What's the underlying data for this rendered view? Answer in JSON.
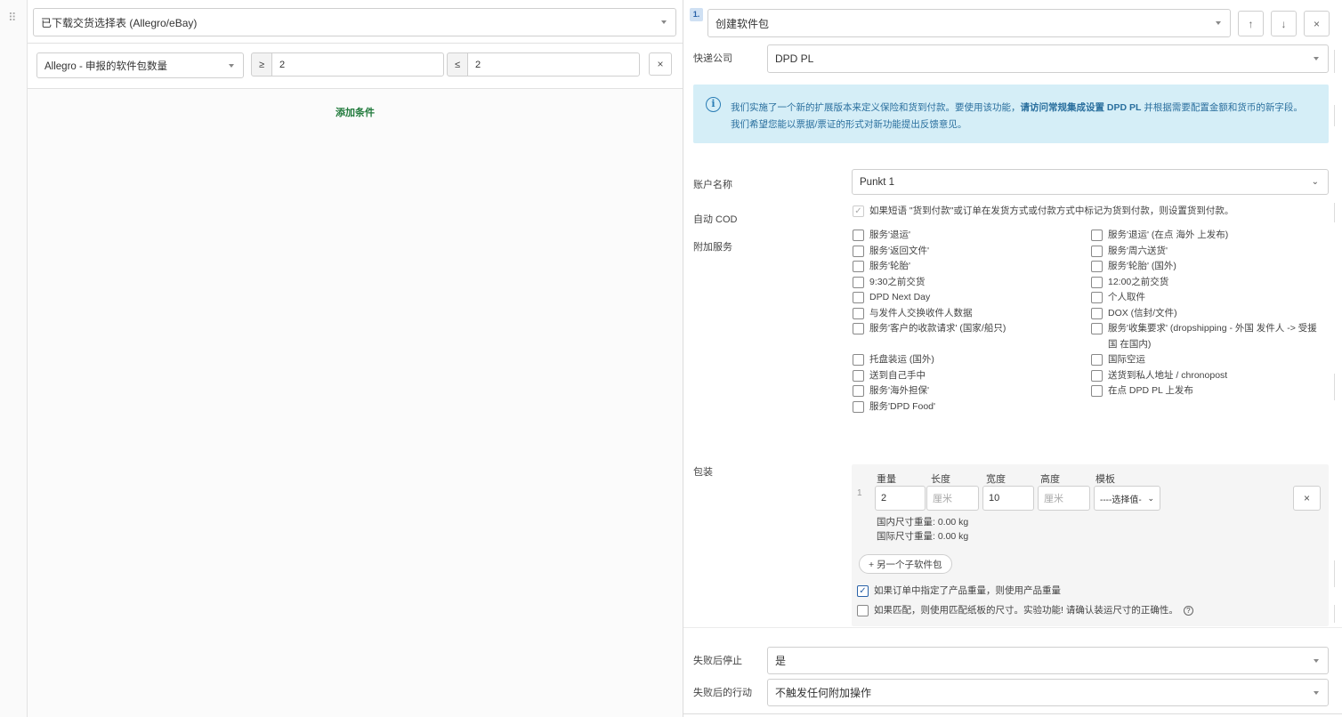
{
  "left": {
    "source_select": "已下载交货选择表 (Allegro/eBay)",
    "condition": {
      "field": "Allegro - 申报的软件包数量",
      "op_min": "≥",
      "min_value": "2",
      "op_max": "≤",
      "max_value": "2",
      "remove": "×"
    },
    "add_condition": "添加条件"
  },
  "right": {
    "badge": "1.",
    "action_select": "创建软件包",
    "move_up": "↑",
    "move_down": "↓",
    "remove": "×",
    "courier_label": "快递公司",
    "courier_value": "DPD PL",
    "info": {
      "icon": "i",
      "text1": "我们实施了一个新的扩展版本来定义保险和货到付款。要使用该功能，",
      "text_bold": "请访问常规集成设置 DPD PL",
      "text2": " 并根据需要配置金额和货币的新字段。",
      "text3": "我们希望您能以票据/票证的形式对新功能提出反馈意见。"
    },
    "account_label": "账户名称",
    "account_value": "Punkt 1",
    "auto_cod_label": "自动 COD",
    "auto_cod_text": "如果短语 \"货到付款\"或订单在发货方式或付款方式中标记为货到付款，则设置货到付款。",
    "extra_services_label": "附加服务",
    "services_left": [
      "服务'退运'",
      "服务'返回文件'",
      "服务'轮胎'",
      "9:30之前交货",
      "DPD Next Day",
      "与发件人交换收件人数据",
      "服务'客户的收款请求' (国家/船只)",
      "托盘装运 (国外)",
      "送到自己手中",
      "服务'海外担保'",
      "服务'DPD Food'"
    ],
    "services_right": [
      "服务'退运' (在点 海外 上发布)",
      "服务'周六送货'",
      "服务'轮胎' (国外)",
      "12:00之前交货",
      "个人取件",
      "DOX (信封/文件)",
      "服务'收集要求' (dropshipping - 外国 发件人 -> 受援国 在国内)",
      "国际空运",
      "送货到私人地址 / chronopost",
      "在点 DPD PL 上发布"
    ],
    "packaging_label": "包装",
    "package": {
      "index": "1",
      "h_weight": "重量",
      "h_length": "长度",
      "h_width": "宽度",
      "h_height": "高度",
      "h_template": "模板",
      "weight": "2",
      "length_ph": "厘米",
      "width": "10",
      "height_ph": "厘米",
      "template": "----选择值-",
      "remove": "×",
      "domestic_weight": "国内尺寸重量: 0.00 kg",
      "intl_weight": "国际尺寸重量: 0.00 kg",
      "add_subpackage": "+ 另一个子软件包",
      "use_product_weight": "如果订单中指定了产品重量，则使用产品重量",
      "use_carton_size": "如果匹配，则使用匹配纸板的尺寸。实验功能! 请确认装运尺寸的正确性。",
      "help": "?"
    },
    "stop_on_fail_label": "失败后停止",
    "stop_on_fail_value": "是",
    "action_after_fail_label": "失败后的行动",
    "action_after_fail_value": "不触发任何附加操作"
  }
}
